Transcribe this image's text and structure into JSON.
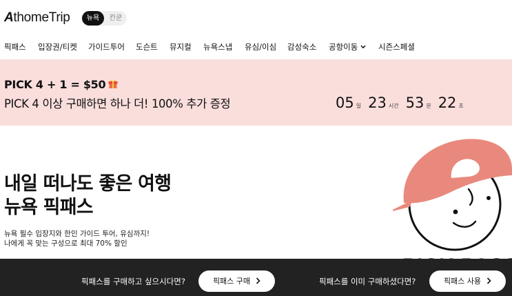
{
  "header": {
    "logo": "AthomeTrip",
    "city_toggle": {
      "active": "뉴욕",
      "inactive": "칸쿤"
    }
  },
  "nav": {
    "items": [
      {
        "label": "픽패스"
      },
      {
        "label": "입장권/티켓"
      },
      {
        "label": "가이드투어"
      },
      {
        "label": "도슨트"
      },
      {
        "label": "뮤지컬"
      },
      {
        "label": "뉴욕스냅"
      },
      {
        "label": "유심/이심"
      },
      {
        "label": "감성숙소"
      },
      {
        "label": "공항이동"
      },
      {
        "label": "시즌스페셜"
      }
    ]
  },
  "promo": {
    "title": "PICK 4 + 1 = $50",
    "subtitle": "PICK 4 이상 구매하면 하나 더! 100% 추가 증정",
    "countdown": {
      "days": "05",
      "days_unit": "일",
      "hours": "23",
      "hours_unit": "시간",
      "minutes": "53",
      "minutes_unit": "분",
      "seconds": "22",
      "seconds_unit": "초"
    },
    "bg_color": "#f9dedc"
  },
  "hero": {
    "title_line1": "내일 떠나도 좋은 여행",
    "title_line2": "뉴욕 픽패스",
    "desc_line1": "뉴욕 필수 입장지와 한인 가이드 투어, 유심까지!",
    "desc_line2": "나에게 꼭 맞는 구성으로 최대 70% 할인",
    "mascot_text": "PICK PASS",
    "mascot_hat_color": "#e9897d"
  },
  "bottom_bar": {
    "buy_prompt": "픽패스를 구매하고 싶으시다면?",
    "buy_button": "픽패스 구매",
    "use_prompt": "픽패스를 이미 구매하셨다면?",
    "use_button": "픽패스 사용"
  }
}
